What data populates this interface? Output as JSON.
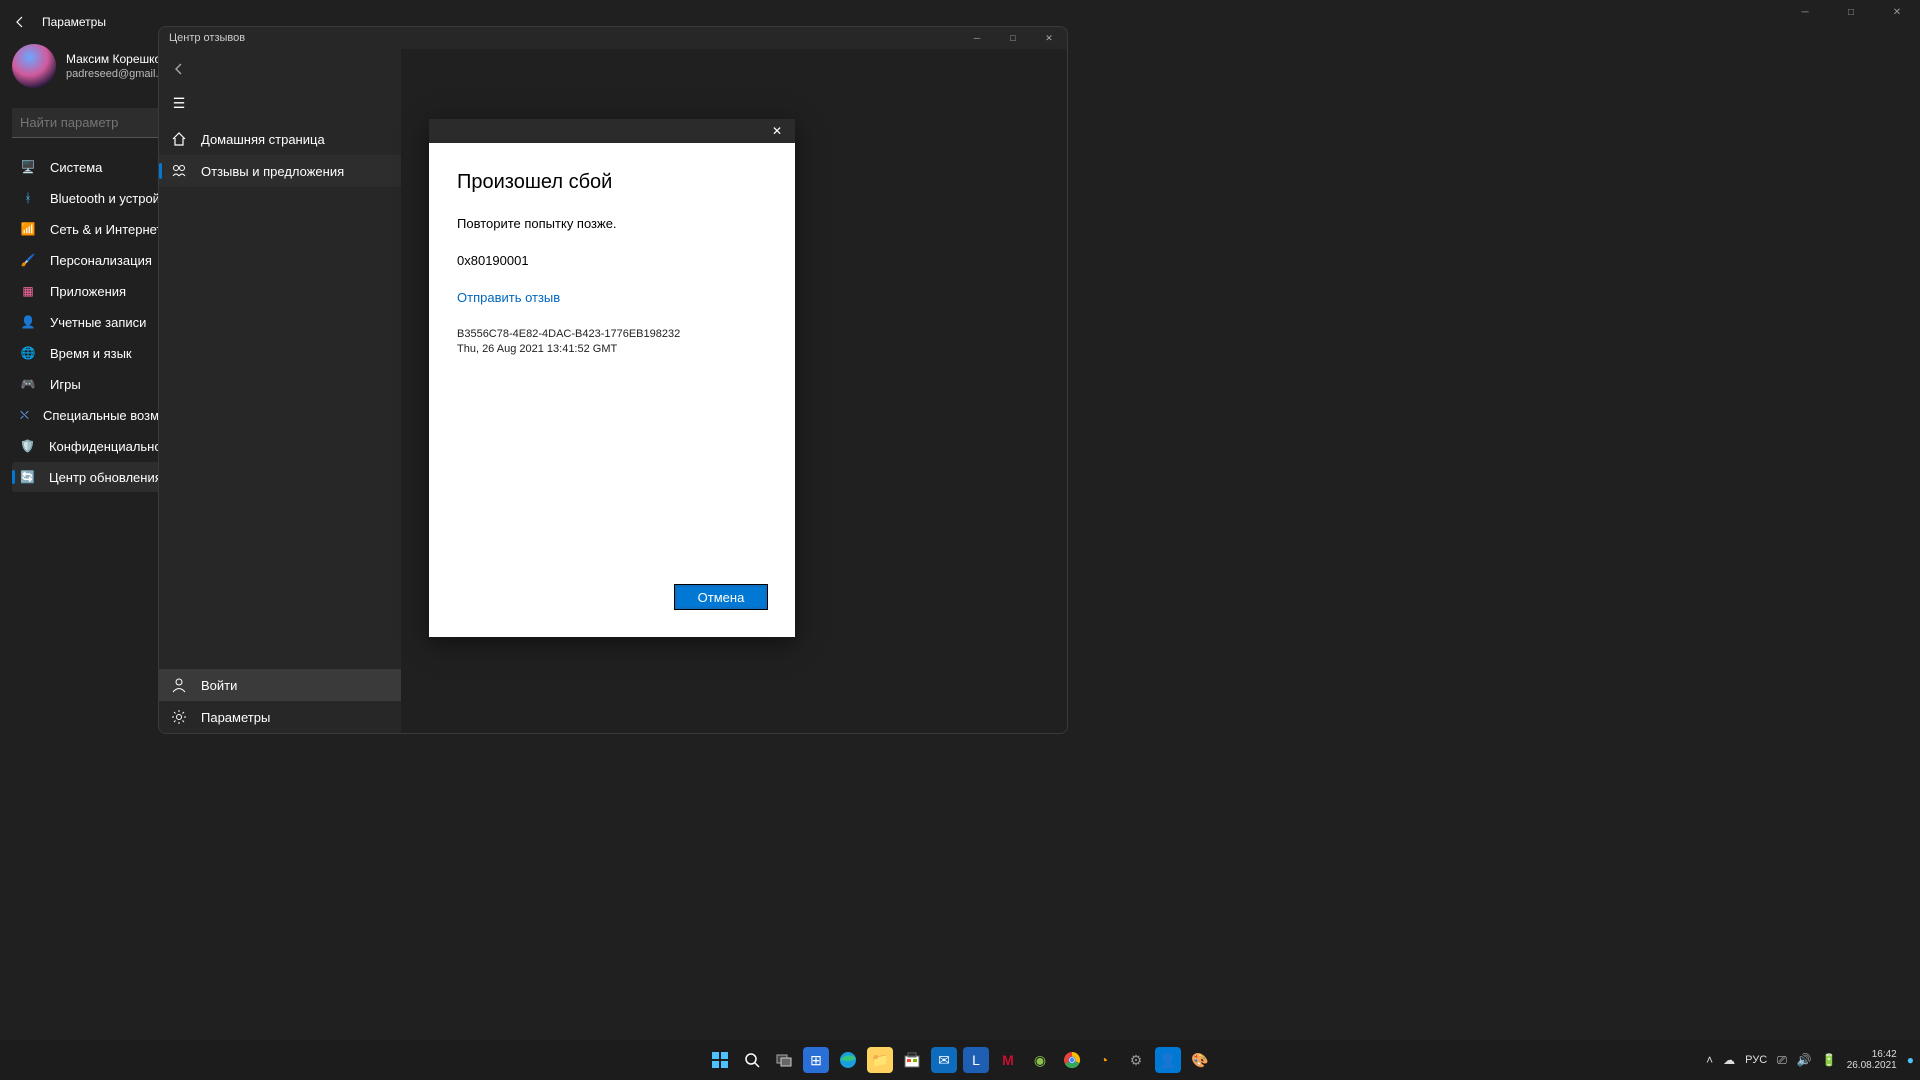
{
  "settings": {
    "title": "Параметры",
    "profile_name": "Максим Корешков",
    "profile_email": "padreseed@gmail.com",
    "search_placeholder": "Найти параметр",
    "nav": [
      {
        "label": "Система",
        "icon": "🖥️",
        "color": "#4cc2ff"
      },
      {
        "label": "Bluetooth и устройства",
        "icon": "ᚼ",
        "color": "#4cc2ff"
      },
      {
        "label": "Сеть & и Интернет",
        "icon": "📶",
        "color": "#4cc2ff"
      },
      {
        "label": "Персонализация",
        "icon": "🖌️",
        "color": "#ff8c00"
      },
      {
        "label": "Приложения",
        "icon": "▦",
        "color": "#ff6aa2"
      },
      {
        "label": "Учетные записи",
        "icon": "👤",
        "color": "#5ad2b1"
      },
      {
        "label": "Время и язык",
        "icon": "🌐",
        "color": "#a47cff"
      },
      {
        "label": "Игры",
        "icon": "🎮",
        "color": "#bbb"
      },
      {
        "label": "Специальные возможности",
        "icon": "⛌",
        "color": "#6aa8ff"
      },
      {
        "label": "Конфиденциальность и защита",
        "icon": "🛡️",
        "color": "#bbb"
      },
      {
        "label": "Центр обновления Windows",
        "icon": "🔄",
        "color": "#0078d4"
      }
    ],
    "selected_index": 10
  },
  "feedback_hub": {
    "title": "Центр отзывов",
    "nav": [
      {
        "label": "Домашняя страница",
        "icon": "home"
      },
      {
        "label": "Отзывы и предложения",
        "icon": "feedback"
      }
    ],
    "selected_index": 1,
    "bottom": [
      {
        "label": "Войти",
        "icon": "person",
        "selected": true
      },
      {
        "label": "Параметры",
        "icon": "gear",
        "selected": false
      }
    ]
  },
  "dialog": {
    "title": "Произошел сбой",
    "message": "Повторите попытку позже.",
    "error_code": "0x80190001",
    "link_text": "Отправить отзыв",
    "guid": "B3556C78-4E82-4DAC-B423-1776EB198232",
    "timestamp": "Thu, 26 Aug 2021 13:41:52 GMT",
    "cancel": "Отмена"
  },
  "systray": {
    "lang": "РУС",
    "time": "16:42",
    "date": "26.08.2021"
  }
}
